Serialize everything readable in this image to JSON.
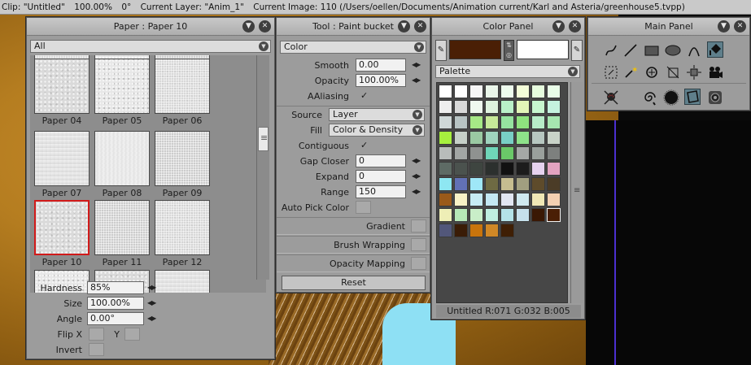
{
  "statusbar": {
    "clip": "Clip: \"Untitled\"",
    "zoom": "100.00%",
    "angle": "0°",
    "layer": "Current Layer: \"Anim_1\"",
    "image": "Current Image: 110 (/Users/oellen/Documents/Animation current/Karl and Asteria/greenhouse5.tvpp)"
  },
  "paper_panel": {
    "title": "Paper : Paper 10",
    "filter": "All",
    "papers": [
      {
        "label": "Paper 04"
      },
      {
        "label": "Paper 05"
      },
      {
        "label": "Paper 06"
      },
      {
        "label": "Paper 07"
      },
      {
        "label": "Paper 08"
      },
      {
        "label": "Paper 09"
      },
      {
        "label": "Paper 10"
      },
      {
        "label": "Paper 11"
      },
      {
        "label": "Paper 12"
      }
    ],
    "selected": "Paper 10",
    "hardness_label": "Hardness",
    "hardness": "85%",
    "size_label": "Size",
    "size": "100.00%",
    "angle_label": "Angle",
    "angle": "0.00°",
    "flipx_label": "Flip X",
    "flipy_label": "Y",
    "invert_label": "Invert"
  },
  "tool_panel": {
    "title": "Tool : Paint bucket",
    "mode": "Color",
    "smooth_label": "Smooth",
    "smooth": "0.00",
    "opacity_label": "Opacity",
    "opacity": "100.00%",
    "aaliasing_label": "AAliasing",
    "aaliasing_check": "✓",
    "source_label": "Source",
    "source": "Layer",
    "fill_label": "Fill",
    "fill": "Color & Density",
    "contiguous_label": "Contiguous",
    "contiguous_check": "✓",
    "gap_closer_label": "Gap Closer",
    "gap_closer": "0",
    "expand_label": "Expand",
    "expand": "0",
    "range_label": "Range",
    "range": "150",
    "autopick_label": "Auto Pick Color",
    "gradient_label": "Gradient",
    "brush_wrapping_label": "Brush Wrapping",
    "opacity_mapping_label": "Opacity Mapping",
    "reset_label": "Reset"
  },
  "color_panel": {
    "title": "Color Panel",
    "primary_color": "#4a1f05",
    "secondary_color": "#ffffff",
    "palette_label": "Palette",
    "status": "Untitled R:071 G:032 B:005",
    "palette_rows": [
      [
        "#ffffff",
        "#ffffff",
        "#f6f6f6",
        "#eaf6ea",
        "#eefcee",
        "#f3fdd8",
        "#e6fcde",
        "#e9fde8"
      ],
      [
        "#eeeeee",
        "#d9d9d9",
        "#eff9ef",
        "#dff3df",
        "#b9f0c8",
        "#e2f5b8",
        "#c7f6cf",
        "#c5f2df"
      ],
      [
        "#cfd8d8",
        "#b8c4c4",
        "#a6e886",
        "#c7e999",
        "#95e39f",
        "#8ee27e",
        "#b7ecc8",
        "#a6e6b0"
      ],
      [
        "#a6f03e",
        "#c6d0c8",
        "#9ac9a2",
        "#9fd3bd",
        "#78cfc5",
        "#8ee28a",
        "#b7c7c0",
        "#c9d3c8"
      ],
      [
        "#b8bcba",
        "#a2a6a4",
        "#8f9290",
        "#6fd5b8",
        "#6ac868",
        "#a5a8a6",
        "#9aa09c",
        "#7d807e"
      ],
      [
        "#5e6b65",
        "#4b524e",
        "#3e4540",
        "#2c302e",
        "#111111",
        "#1c1c1c",
        "#e6d2ef",
        "#e3a3c1"
      ],
      [
        "#8ee7f2",
        "#6271b6",
        "#9fe7f8",
        "#6e6a43",
        "#c6bd90",
        "#a19f80",
        "#5e4b2b",
        "#4b3c27"
      ],
      [
        "#9a5a1a",
        "#f8f2c7",
        "#c7ecf4",
        "#c4e8f3",
        "#e1e6f2",
        "#cfe9f0",
        "#efe7b5",
        "#f3d0b2"
      ],
      [
        "#eeeeb6",
        "#b6e8b8",
        "#c9eec8",
        "#bfeee0",
        "#b4e2e8",
        "#c6e0ec",
        "#3a1804",
        "#4a1f05"
      ],
      [
        "#52577a",
        "#3a1c06",
        "#c8740c",
        "#d08826",
        "#3f1f05"
      ]
    ],
    "selected_cell": "#4a1f05"
  },
  "main_panel": {
    "title": "Main Panel",
    "row1": [
      "freehand-line-tool-icon",
      "straight-line-tool-icon",
      "rectangle-tool-icon",
      "ellipse-tool-icon",
      "curve-tool-icon",
      "paint-bucket-tool-icon"
    ],
    "row2": [
      "rect-cut-tool-icon",
      "magic-wand-tool-icon",
      "zoom-tool-icon",
      "crop-tool-icon",
      "pan-tool-icon",
      "camera-tool-icon"
    ],
    "row3": [
      "cutout-brush-icon",
      "lasso-spiral-icon",
      "blob-brush-icon",
      "paper-texture-icon",
      "settings-gear-icon"
    ],
    "active_tools": [
      "paint-bucket-tool-icon",
      "paper-texture-icon"
    ]
  }
}
